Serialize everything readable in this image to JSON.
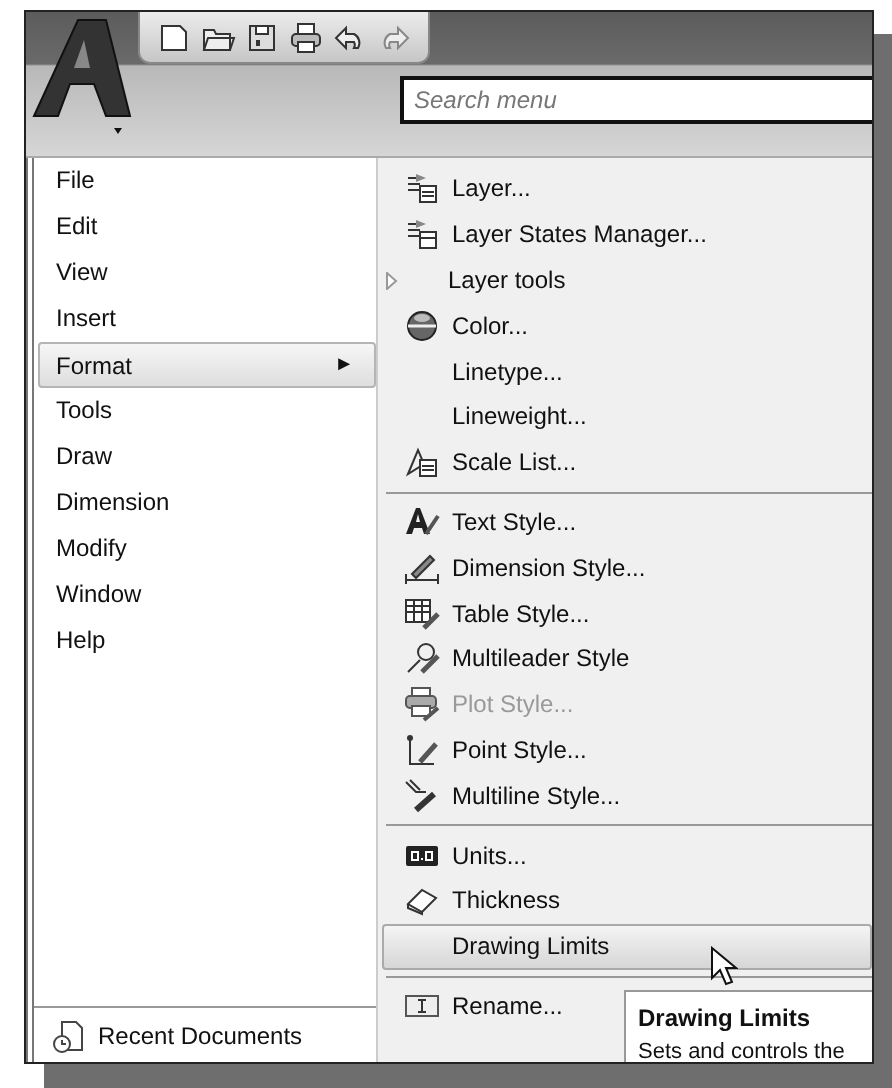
{
  "search": {
    "placeholder": "Search menu"
  },
  "menu_bar": [
    {
      "label": "File",
      "selected": false
    },
    {
      "label": "Edit",
      "selected": false
    },
    {
      "label": "View",
      "selected": false
    },
    {
      "label": "Insert",
      "selected": false
    },
    {
      "label": "Format",
      "selected": true,
      "arrow": "►"
    },
    {
      "label": "Tools",
      "selected": false
    },
    {
      "label": "Draw",
      "selected": false
    },
    {
      "label": "Dimension",
      "selected": false
    },
    {
      "label": "Modify",
      "selected": false
    },
    {
      "label": "Window",
      "selected": false
    },
    {
      "label": "Help",
      "selected": false
    }
  ],
  "recent_documents": {
    "label": "Recent Documents"
  },
  "format_menu": [
    [
      {
        "label": "Layer...",
        "disabled": false,
        "selected": false,
        "submenu": false
      },
      {
        "label": "Layer States Manager...",
        "disabled": false,
        "selected": false,
        "submenu": false
      },
      {
        "label": "Layer tools",
        "disabled": false,
        "selected": false,
        "submenu": true
      },
      {
        "label": "Color...",
        "disabled": false,
        "selected": false,
        "submenu": false
      },
      {
        "label": "Linetype...",
        "disabled": false,
        "selected": false,
        "submenu": false
      },
      {
        "label": "Lineweight...",
        "disabled": false,
        "selected": false,
        "submenu": false
      },
      {
        "label": "Scale List...",
        "disabled": false,
        "selected": false,
        "submenu": false
      }
    ],
    [
      {
        "label": "Text Style...",
        "disabled": false,
        "selected": false,
        "submenu": false
      },
      {
        "label": "Dimension Style...",
        "disabled": false,
        "selected": false,
        "submenu": false
      },
      {
        "label": "Table Style...",
        "disabled": false,
        "selected": false,
        "submenu": false
      },
      {
        "label": "Multileader Style",
        "disabled": false,
        "selected": false,
        "submenu": false
      },
      {
        "label": "Plot Style...",
        "disabled": true,
        "selected": false,
        "submenu": false
      },
      {
        "label": "Point Style...",
        "disabled": false,
        "selected": false,
        "submenu": false
      },
      {
        "label": "Multiline Style...",
        "disabled": false,
        "selected": false,
        "submenu": false
      }
    ],
    [
      {
        "label": "Units...",
        "disabled": false,
        "selected": false,
        "submenu": false
      },
      {
        "label": "Thickness",
        "disabled": false,
        "selected": false,
        "submenu": false
      },
      {
        "label": "Drawing Limits",
        "disabled": false,
        "selected": true,
        "submenu": false
      }
    ],
    [
      {
        "label": "Rename...",
        "disabled": false,
        "selected": false,
        "submenu": false
      }
    ]
  ],
  "tooltip": {
    "title": "Drawing Limits",
    "text": "Sets and controls the"
  }
}
